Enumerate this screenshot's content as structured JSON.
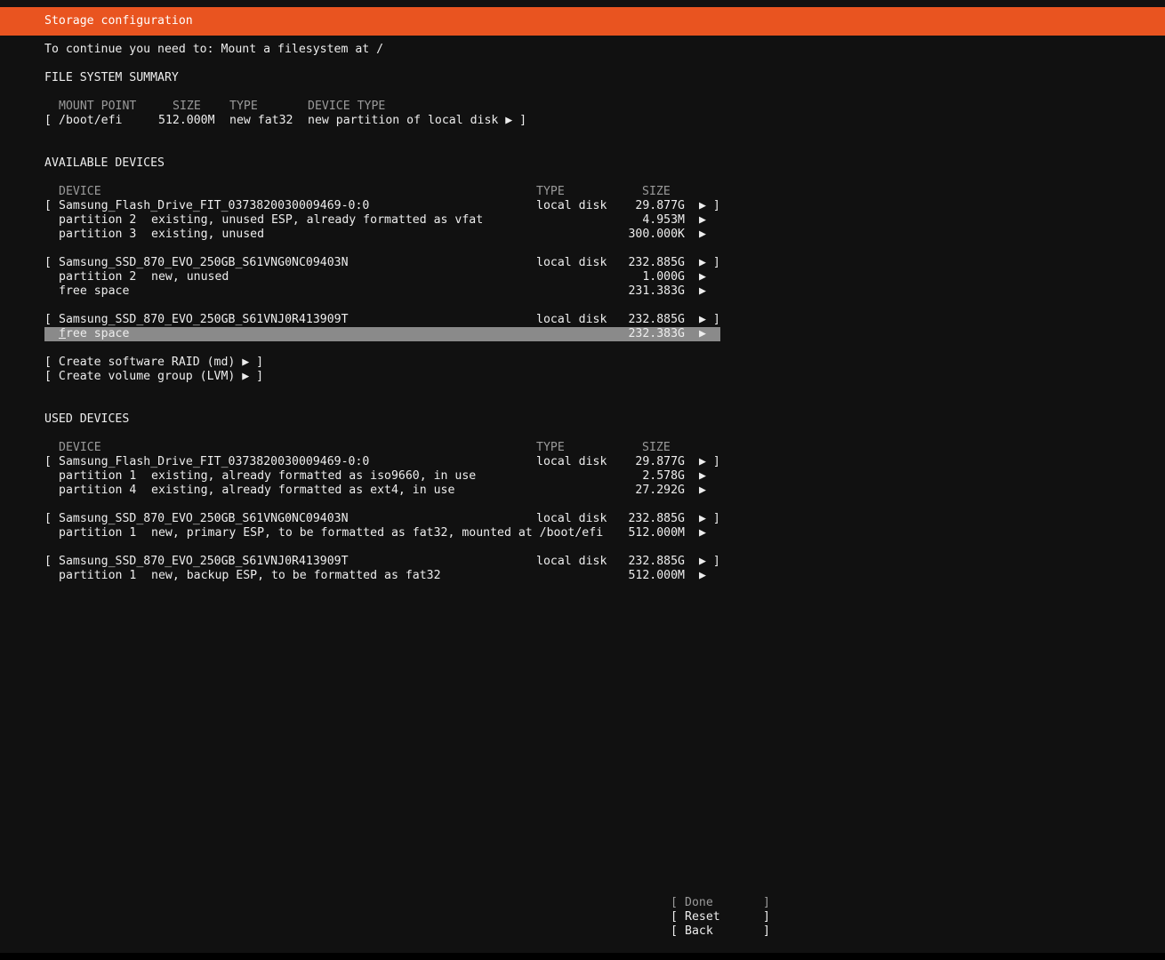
{
  "header": {
    "title": "Storage configuration"
  },
  "notice": "To continue you need to: Mount a filesystem at /",
  "fs_summary": {
    "heading": "FILE SYSTEM SUMMARY",
    "columns": {
      "mount": "MOUNT POINT",
      "size": "SIZE",
      "type": "TYPE",
      "device_type": "DEVICE TYPE"
    },
    "rows": [
      {
        "open": "[",
        "mount": "/boot/efi",
        "size": "512.000M",
        "type": "new fat32",
        "device_type": "new partition of local disk ▶ ]"
      }
    ]
  },
  "available": {
    "heading": "AVAILABLE DEVICES",
    "columns": {
      "device": "DEVICE",
      "type": "TYPE",
      "size": "SIZE"
    },
    "disk1": {
      "open": "[",
      "name": "Samsung_Flash_Drive_FIT_0373820030009469-0:0",
      "type": "local disk",
      "size": "29.877G",
      "arrow": "▶ ]",
      "p2": {
        "label": "partition 2",
        "desc": "existing, unused ESP, already formatted as vfat",
        "size": "4.953M",
        "arrow": "▶"
      },
      "p3": {
        "label": "partition 3",
        "desc": "existing, unused",
        "size": "300.000K",
        "arrow": "▶"
      }
    },
    "disk2": {
      "open": "[",
      "name": "Samsung_SSD_870_EVO_250GB_S61VNG0NC09403N",
      "type": "local disk",
      "size": "232.885G",
      "arrow": "▶ ]",
      "p2": {
        "label": "partition 2",
        "desc": "new, unused",
        "size": "1.000G",
        "arrow": "▶"
      },
      "free": {
        "label": "free space",
        "size": "231.383G",
        "arrow": "▶"
      }
    },
    "disk3": {
      "open": "[",
      "name": "Samsung_SSD_870_EVO_250GB_S61VNJ0R413909T",
      "type": "local disk",
      "size": "232.885G",
      "arrow": "▶ ]",
      "free": {
        "label_first": "f",
        "label_rest": "ree space",
        "size": "232.383G",
        "arrow": "▶"
      }
    },
    "create_raid": "[ Create software RAID (md) ▶ ]",
    "create_lvm": "[ Create volume group (LVM) ▶ ]"
  },
  "used": {
    "heading": "USED DEVICES",
    "columns": {
      "device": "DEVICE",
      "type": "TYPE",
      "size": "SIZE"
    },
    "disk1": {
      "open": "[",
      "name": "Samsung_Flash_Drive_FIT_0373820030009469-0:0",
      "type": "local disk",
      "size": "29.877G",
      "arrow": "▶ ]",
      "p1": {
        "label": "partition 1",
        "desc": "existing, already formatted as iso9660, in use",
        "size": "2.578G",
        "arrow": "▶"
      },
      "p4": {
        "label": "partition 4",
        "desc": "existing, already formatted as ext4, in use",
        "size": "27.292G",
        "arrow": "▶"
      }
    },
    "disk2": {
      "open": "[",
      "name": "Samsung_SSD_870_EVO_250GB_S61VNG0NC09403N",
      "type": "local disk",
      "size": "232.885G",
      "arrow": "▶ ]",
      "p1": {
        "label": "partition 1",
        "desc": "new, primary ESP, to be formatted as fat32, mounted at /boot/efi",
        "size": "512.000M",
        "arrow": "▶"
      }
    },
    "disk3": {
      "open": "[",
      "name": "Samsung_SSD_870_EVO_250GB_S61VNJ0R413909T",
      "type": "local disk",
      "size": "232.885G",
      "arrow": "▶ ]",
      "p1": {
        "label": "partition 1",
        "desc": "new, backup ESP, to be formatted as fat32",
        "size": "512.000M",
        "arrow": "▶"
      }
    }
  },
  "buttons": {
    "done": {
      "open": "[",
      "label": "Done",
      "close": "]"
    },
    "reset": {
      "open": "[",
      "label": "Reset",
      "close": "]"
    },
    "back": {
      "open": "[",
      "label": "Back",
      "close": "]"
    }
  },
  "colors": {
    "accent": "#e95420",
    "background": "#111111",
    "selection": "#8a8a8a",
    "dim_text": "#9a9a9a"
  }
}
